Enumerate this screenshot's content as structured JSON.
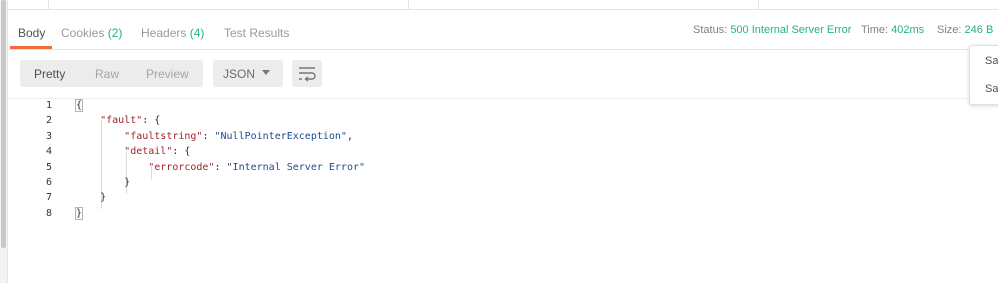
{
  "tabs": [
    {
      "label": "Body",
      "count": ""
    },
    {
      "label": "Cookies",
      "count": "(2)"
    },
    {
      "label": "Headers",
      "count": "(4)"
    },
    {
      "label": "Test Results",
      "count": ""
    }
  ],
  "status": {
    "status_label": "Status:",
    "status_value": "500 Internal Server Error",
    "time_label": "Time:",
    "time_value": "402ms",
    "size_label": "Size:",
    "size_value": "246 B"
  },
  "format_buttons": [
    "Pretty",
    "Raw",
    "Preview"
  ],
  "format_select": {
    "value": "JSON"
  },
  "popup_items": [
    "Sav",
    "Sav"
  ],
  "code_lines": [
    {
      "num": "1",
      "indent": "",
      "parts": [
        {
          "t": "{",
          "c": "p"
        }
      ]
    },
    {
      "num": "2",
      "indent": "    ",
      "parts": [
        {
          "t": "\"fault\"",
          "c": "key"
        },
        {
          "t": ": {",
          "c": "p"
        }
      ]
    },
    {
      "num": "3",
      "indent": "        ",
      "parts": [
        {
          "t": "\"faultstring\"",
          "c": "key"
        },
        {
          "t": ": ",
          "c": "p"
        },
        {
          "t": "\"NullPointerException\"",
          "c": "str"
        },
        {
          "t": ",",
          "c": "p"
        }
      ]
    },
    {
      "num": "4",
      "indent": "        ",
      "parts": [
        {
          "t": "\"detail\"",
          "c": "key"
        },
        {
          "t": ": {",
          "c": "p"
        }
      ]
    },
    {
      "num": "5",
      "indent": "            ",
      "parts": [
        {
          "t": "\"errorcode\"",
          "c": "key"
        },
        {
          "t": ": ",
          "c": "p"
        },
        {
          "t": "\"Internal Server Error\"",
          "c": "str"
        }
      ]
    },
    {
      "num": "6",
      "indent": "        ",
      "parts": [
        {
          "t": "}",
          "c": "p"
        }
      ]
    },
    {
      "num": "7",
      "indent": "    ",
      "parts": [
        {
          "t": "}",
          "c": "p"
        }
      ]
    },
    {
      "num": "8",
      "indent": "",
      "parts": [
        {
          "t": "}",
          "c": "p"
        }
      ]
    }
  ],
  "colors": {
    "accent": "#f26b3a",
    "success": "#24b37e",
    "json_key": "#a0252e",
    "json_string": "#1d4b8f"
  },
  "icons": {
    "wrap": "wrap-lines-icon",
    "caret": "chevron-down-icon"
  }
}
